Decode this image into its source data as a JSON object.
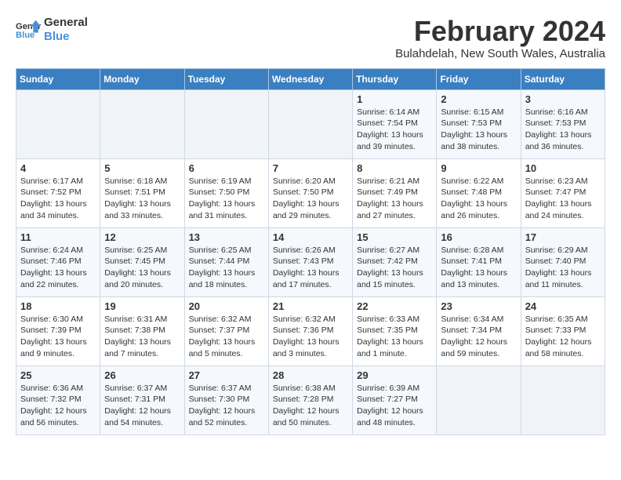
{
  "logo": {
    "line1": "General",
    "line2": "Blue"
  },
  "title": "February 2024",
  "subtitle": "Bulahdelah, New South Wales, Australia",
  "days_of_week": [
    "Sunday",
    "Monday",
    "Tuesday",
    "Wednesday",
    "Thursday",
    "Friday",
    "Saturday"
  ],
  "weeks": [
    [
      {
        "day": "",
        "info": ""
      },
      {
        "day": "",
        "info": ""
      },
      {
        "day": "",
        "info": ""
      },
      {
        "day": "",
        "info": ""
      },
      {
        "day": "1",
        "info": "Sunrise: 6:14 AM\nSunset: 7:54 PM\nDaylight: 13 hours\nand 39 minutes."
      },
      {
        "day": "2",
        "info": "Sunrise: 6:15 AM\nSunset: 7:53 PM\nDaylight: 13 hours\nand 38 minutes."
      },
      {
        "day": "3",
        "info": "Sunrise: 6:16 AM\nSunset: 7:53 PM\nDaylight: 13 hours\nand 36 minutes."
      }
    ],
    [
      {
        "day": "4",
        "info": "Sunrise: 6:17 AM\nSunset: 7:52 PM\nDaylight: 13 hours\nand 34 minutes."
      },
      {
        "day": "5",
        "info": "Sunrise: 6:18 AM\nSunset: 7:51 PM\nDaylight: 13 hours\nand 33 minutes."
      },
      {
        "day": "6",
        "info": "Sunrise: 6:19 AM\nSunset: 7:50 PM\nDaylight: 13 hours\nand 31 minutes."
      },
      {
        "day": "7",
        "info": "Sunrise: 6:20 AM\nSunset: 7:50 PM\nDaylight: 13 hours\nand 29 minutes."
      },
      {
        "day": "8",
        "info": "Sunrise: 6:21 AM\nSunset: 7:49 PM\nDaylight: 13 hours\nand 27 minutes."
      },
      {
        "day": "9",
        "info": "Sunrise: 6:22 AM\nSunset: 7:48 PM\nDaylight: 13 hours\nand 26 minutes."
      },
      {
        "day": "10",
        "info": "Sunrise: 6:23 AM\nSunset: 7:47 PM\nDaylight: 13 hours\nand 24 minutes."
      }
    ],
    [
      {
        "day": "11",
        "info": "Sunrise: 6:24 AM\nSunset: 7:46 PM\nDaylight: 13 hours\nand 22 minutes."
      },
      {
        "day": "12",
        "info": "Sunrise: 6:25 AM\nSunset: 7:45 PM\nDaylight: 13 hours\nand 20 minutes."
      },
      {
        "day": "13",
        "info": "Sunrise: 6:25 AM\nSunset: 7:44 PM\nDaylight: 13 hours\nand 18 minutes."
      },
      {
        "day": "14",
        "info": "Sunrise: 6:26 AM\nSunset: 7:43 PM\nDaylight: 13 hours\nand 17 minutes."
      },
      {
        "day": "15",
        "info": "Sunrise: 6:27 AM\nSunset: 7:42 PM\nDaylight: 13 hours\nand 15 minutes."
      },
      {
        "day": "16",
        "info": "Sunrise: 6:28 AM\nSunset: 7:41 PM\nDaylight: 13 hours\nand 13 minutes."
      },
      {
        "day": "17",
        "info": "Sunrise: 6:29 AM\nSunset: 7:40 PM\nDaylight: 13 hours\nand 11 minutes."
      }
    ],
    [
      {
        "day": "18",
        "info": "Sunrise: 6:30 AM\nSunset: 7:39 PM\nDaylight: 13 hours\nand 9 minutes."
      },
      {
        "day": "19",
        "info": "Sunrise: 6:31 AM\nSunset: 7:38 PM\nDaylight: 13 hours\nand 7 minutes."
      },
      {
        "day": "20",
        "info": "Sunrise: 6:32 AM\nSunset: 7:37 PM\nDaylight: 13 hours\nand 5 minutes."
      },
      {
        "day": "21",
        "info": "Sunrise: 6:32 AM\nSunset: 7:36 PM\nDaylight: 13 hours\nand 3 minutes."
      },
      {
        "day": "22",
        "info": "Sunrise: 6:33 AM\nSunset: 7:35 PM\nDaylight: 13 hours\nand 1 minute."
      },
      {
        "day": "23",
        "info": "Sunrise: 6:34 AM\nSunset: 7:34 PM\nDaylight: 12 hours\nand 59 minutes."
      },
      {
        "day": "24",
        "info": "Sunrise: 6:35 AM\nSunset: 7:33 PM\nDaylight: 12 hours\nand 58 minutes."
      }
    ],
    [
      {
        "day": "25",
        "info": "Sunrise: 6:36 AM\nSunset: 7:32 PM\nDaylight: 12 hours\nand 56 minutes."
      },
      {
        "day": "26",
        "info": "Sunrise: 6:37 AM\nSunset: 7:31 PM\nDaylight: 12 hours\nand 54 minutes."
      },
      {
        "day": "27",
        "info": "Sunrise: 6:37 AM\nSunset: 7:30 PM\nDaylight: 12 hours\nand 52 minutes."
      },
      {
        "day": "28",
        "info": "Sunrise: 6:38 AM\nSunset: 7:28 PM\nDaylight: 12 hours\nand 50 minutes."
      },
      {
        "day": "29",
        "info": "Sunrise: 6:39 AM\nSunset: 7:27 PM\nDaylight: 12 hours\nand 48 minutes."
      },
      {
        "day": "",
        "info": ""
      },
      {
        "day": "",
        "info": ""
      }
    ]
  ]
}
